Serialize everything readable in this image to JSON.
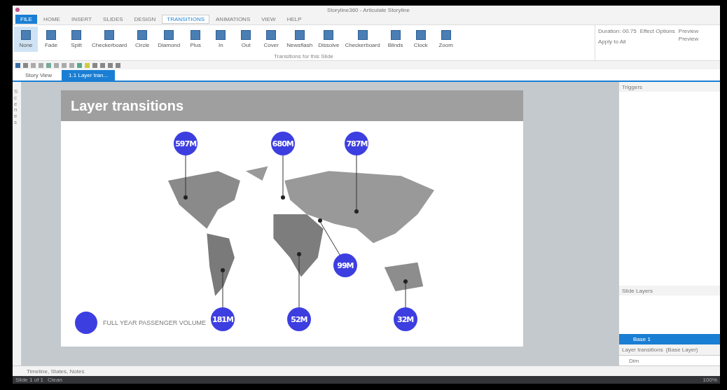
{
  "window": {
    "title": "Storyline360 - Articulate Storyline"
  },
  "ribbon_tabs": [
    {
      "label": "FILE",
      "selected": false,
      "kind": "file"
    },
    {
      "label": "HOME",
      "selected": false,
      "kind": "tab"
    },
    {
      "label": "INSERT",
      "selected": false,
      "kind": "tab"
    },
    {
      "label": "SLIDES",
      "selected": false,
      "kind": "tab"
    },
    {
      "label": "DESIGN",
      "selected": false,
      "kind": "tab"
    },
    {
      "label": "TRANSITIONS",
      "selected": true,
      "kind": "tab"
    },
    {
      "label": "ANIMATIONS",
      "selected": false,
      "kind": "tab"
    },
    {
      "label": "VIEW",
      "selected": false,
      "kind": "tab"
    },
    {
      "label": "HELP",
      "selected": false,
      "kind": "tab"
    }
  ],
  "transitions": [
    {
      "label": "None",
      "selected": true
    },
    {
      "label": "Fade",
      "selected": false
    },
    {
      "label": "Split",
      "selected": false
    },
    {
      "label": "Checkerboard",
      "selected": false
    },
    {
      "label": "Circle",
      "selected": false
    },
    {
      "label": "Diamond",
      "selected": false
    },
    {
      "label": "Plus",
      "selected": false
    },
    {
      "label": "In",
      "selected": false
    },
    {
      "label": "Out",
      "selected": false
    },
    {
      "label": "Cover",
      "selected": false
    },
    {
      "label": "Newsflash",
      "selected": false
    },
    {
      "label": "Dissolve",
      "selected": false
    },
    {
      "label": "Checkerboard",
      "selected": false
    },
    {
      "label": "Blinds",
      "selected": false
    },
    {
      "label": "Clock",
      "selected": false
    },
    {
      "label": "Zoom",
      "selected": false
    }
  ],
  "ribbon_caption": "Transitions for this Slide",
  "timing": {
    "duration": "Duration: 00.75",
    "apply": "Apply to All",
    "effect": "Effect Options",
    "preview": "Preview",
    "preview_group": "Preview"
  },
  "doc_tabs": [
    {
      "label": "Story View",
      "selected": false
    },
    {
      "label": "1.1 Layer tran...",
      "selected": true
    }
  ],
  "slide": {
    "title": "Layer transitions",
    "pins": [
      {
        "label": "597M"
      },
      {
        "label": "680M"
      },
      {
        "label": "787M"
      },
      {
        "label": "99M"
      },
      {
        "label": "181M"
      },
      {
        "label": "52M"
      },
      {
        "label": "32M"
      }
    ],
    "legend": "FULL YEAR PASSENGER VOLUME"
  },
  "scenes_label": "Scenes",
  "triggers": {
    "title": "Triggers"
  },
  "slide_layers": {
    "title": "Slide Layers",
    "layers": [
      {
        "label": "Base 1",
        "selected": true
      },
      {
        "label": "Layer transitions",
        "selected": false,
        "status": "(Base Layer)"
      }
    ],
    "option": "Dim"
  },
  "bottom_tabs": "Timeline, States, Notes",
  "status": {
    "slide": "Slide 1 of 1",
    "state": "Clean",
    "zoom": "100%"
  }
}
